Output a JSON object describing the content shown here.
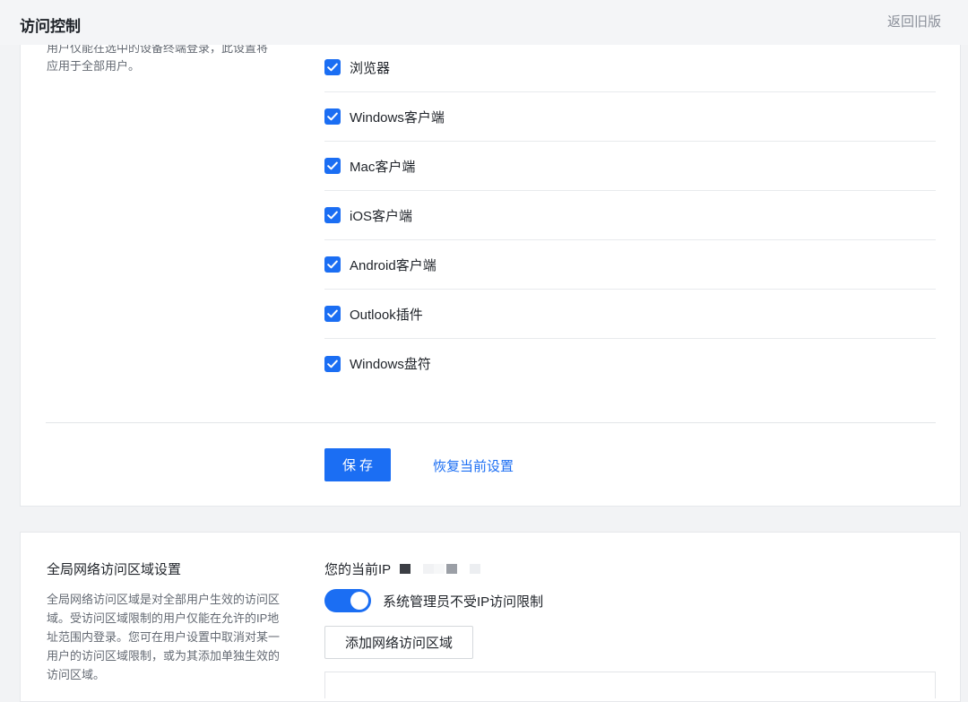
{
  "header": {
    "title": "访问控制",
    "back_link": "返回旧版"
  },
  "device_section": {
    "description_lines": [
      "用户仅能在选中的设备终端登录，此设置将",
      "应用于全部用户。"
    ],
    "checkbox_color": "#1b6ef3",
    "items": [
      {
        "label": "浏览器",
        "checked": true
      },
      {
        "label": "Windows客户端",
        "checked": true
      },
      {
        "label": "Mac客户端",
        "checked": true
      },
      {
        "label": "iOS客户端",
        "checked": true
      },
      {
        "label": "Android客户端",
        "checked": true
      },
      {
        "label": "Outlook插件",
        "checked": true
      },
      {
        "label": "Windows盘符",
        "checked": true
      }
    ],
    "save_label": "保存",
    "restore_label": "恢复当前设置"
  },
  "network_section": {
    "title": "全局网络访问区域设置",
    "description": "全局网络访问区域是对全部用户生效的访问区域。受访问区域限制的用户仅能在允许的IP地址范围内登录。您可在用户设置中取消对某一用户的访问区域限制，或为其添加单独生效的访问区域。",
    "current_ip_label": "您的当前IP",
    "admin_exempt_label": "系统管理员不受IP访问限制",
    "admin_exempt_enabled": true,
    "add_zone_label": "添加网络访问区域"
  },
  "colors": {
    "accent": "#1b6ef3",
    "page_bg": "#f2f3f5"
  }
}
